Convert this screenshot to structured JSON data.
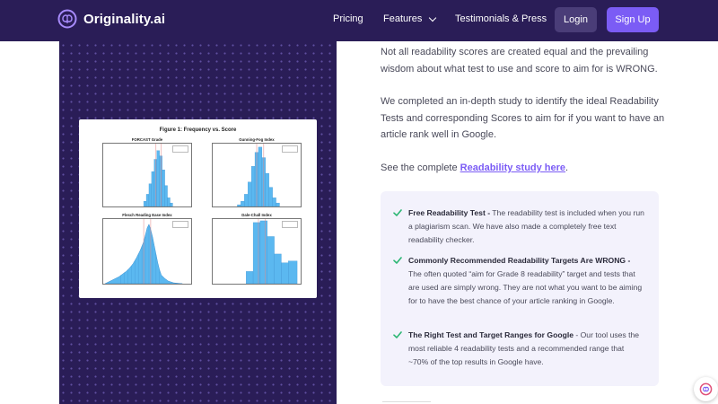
{
  "nav": {
    "brand": "Originality.ai",
    "links": [
      "Pricing",
      "Features",
      "Testimonials & Press"
    ],
    "login": "Login",
    "signup": "Sign Up"
  },
  "figure": {
    "title": "Figure 1: Frequency vs. Score",
    "subplots": [
      "FORCAST Grade",
      "Gunning-Fog Index",
      "Flesch Reading Ease Index",
      "Dale-Chall Index"
    ]
  },
  "content": {
    "p1": "Not all readability scores are created equal and the prevailing wisdom about what test to use and score to aim for is WRONG.",
    "p2": "We completed an in-depth study to identify the ideal Readability Tests and corresponding Scores to aim for if you want to have an article rank well in Google.",
    "p3_prefix": "See the complete ",
    "p3_link": "Readability study here",
    "p3_suffix": "."
  },
  "features": [
    {
      "title": "Free Readability Test -",
      "text": " The readability test is included when you run a plagiarism scan. We have also made a completely free text readability checker."
    },
    {
      "title": "Commonly Recommended Readability Targets Are WRONG -",
      "text": " The often quoted “aim for Grade 8 readability” target and tests that are used are simply wrong. They are not what you want to be aiming for to have the best chance of your article ranking in Google."
    },
    {
      "title": "The Right Test and Target Ranges for Google",
      "text": "  - Our tool uses the most reliable 4 readability tests and a recommended range that ~70% of the top results in Google have."
    }
  ],
  "colors": {
    "nav_bg": "#2a1d57",
    "accent": "#7b5cf5",
    "login_bg": "#4a3d78",
    "check": "#2bb673",
    "bar": "#5bb8f0"
  },
  "icons": {
    "logo": "brain-icon",
    "chevron": "chevron-down-icon",
    "check": "check-icon",
    "fab": "brain-icon"
  }
}
